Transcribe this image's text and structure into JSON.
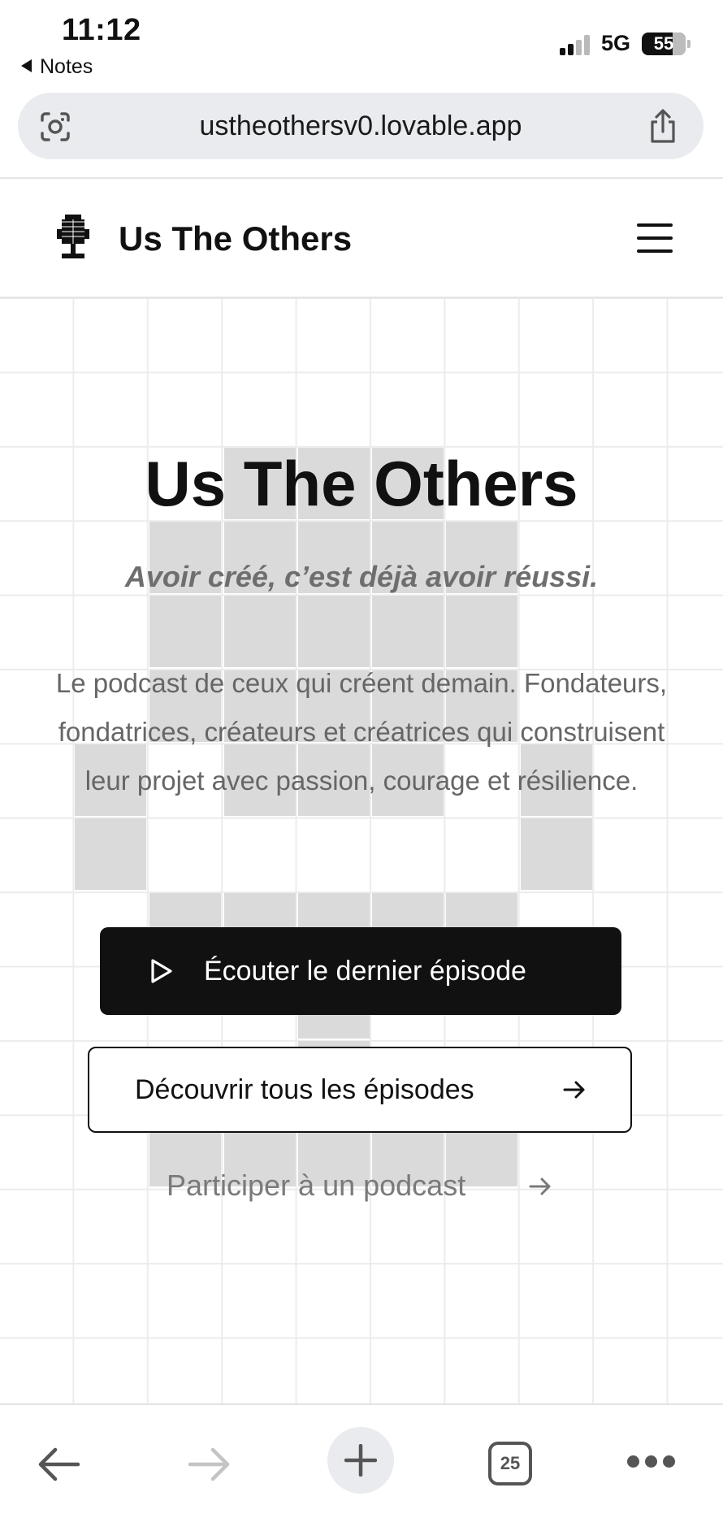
{
  "status_bar": {
    "time": "11:12",
    "back_app": "Notes",
    "network": "5G",
    "battery": "55"
  },
  "browser": {
    "url": "ustheothersv0.lovable.app",
    "tab_count": "25"
  },
  "site": {
    "brand": "Us The Others"
  },
  "hero": {
    "title": "Us The Others",
    "tagline": "Avoir créé, c’est déjà avoir réussi.",
    "description": "Le podcast de ceux qui créent demain. Fondateurs, fondatrices, créateurs et créatrices qui construisent leur projet avec passion, courage et résilience.",
    "primary_button": "Écouter le dernier épisode",
    "secondary_button": "Découvrir tous les épisodes",
    "link": "Participer à un podcast"
  },
  "colors": {
    "accent": "#111111",
    "pixel_fill": "#dadada",
    "grid_line": "#ececec",
    "url_bar": "#e9ebee"
  },
  "icons": {
    "camera_lens": "lens-icon",
    "share": "share-icon",
    "logo": "pixel-microphone-icon",
    "menu": "hamburger-menu-icon",
    "play": "play-icon",
    "arrow": "arrow-right-icon",
    "back": "arrow-left-icon",
    "forward": "arrow-right-icon",
    "new_tab": "plus-icon",
    "tabs": "tabs-icon",
    "more": "more-icon"
  }
}
